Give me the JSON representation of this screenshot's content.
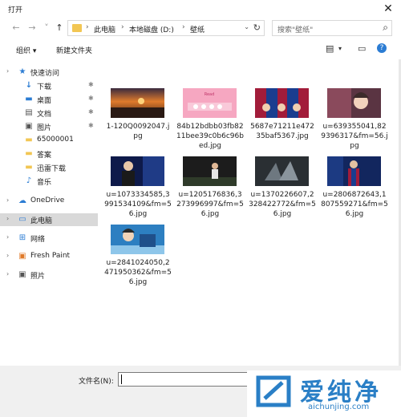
{
  "window": {
    "title": "打开",
    "close_glyph": "✕"
  },
  "nav": {
    "back": "←",
    "forward": "→",
    "recent": "˅",
    "up": "↑"
  },
  "breadcrumb": {
    "items": [
      "此电脑",
      "本地磁盘 (D:)",
      "壁纸"
    ],
    "separator": "›",
    "dropdown": "⌄",
    "refresh": "↻"
  },
  "search": {
    "placeholder": "搜索\"壁纸\"",
    "icon": "search-icon"
  },
  "toolbar": {
    "organize": "组织 ▾",
    "new_folder": "新建文件夹",
    "view_icon": "▤",
    "view_dd": "▾",
    "pane_icon": "▭",
    "help_icon": "?"
  },
  "sidebar": {
    "items": [
      {
        "label": "快速访问",
        "icon": "★",
        "color": "#2b7cd3"
      },
      {
        "label": "下载",
        "icon": "↓",
        "color": "#2b7cd3",
        "pinned": true
      },
      {
        "label": "桌面",
        "icon": "▬",
        "color": "#2b7cd3",
        "pinned": true
      },
      {
        "label": "文档",
        "icon": "▤",
        "color": "#555555",
        "pinned": true
      },
      {
        "label": "图片",
        "icon": "▣",
        "color": "#555555",
        "pinned": true
      },
      {
        "label": "65000001",
        "icon": "▬",
        "color": "#f2c653"
      },
      {
        "label": "答案",
        "icon": "▬",
        "color": "#f2c653"
      },
      {
        "label": "迅雷下载",
        "icon": "▬",
        "color": "#f2c653"
      },
      {
        "label": "音乐",
        "icon": "♪",
        "color": "#2b7cd3"
      },
      {
        "label": "OneDrive",
        "icon": "☁",
        "color": "#2b7cd3"
      },
      {
        "label": "此电脑",
        "icon": "▭",
        "color": "#2b7cd3"
      },
      {
        "label": "网络",
        "icon": "⊞",
        "color": "#2b7cd3"
      },
      {
        "label": "Fresh Paint",
        "icon": "▣",
        "color": "#e07a2a"
      },
      {
        "label": "照片",
        "icon": "▣",
        "color": "#555555"
      }
    ],
    "pin_glyph": "✱",
    "chevron": "›"
  },
  "files": [
    {
      "name": "1-120Q0092047.jpg"
    },
    {
      "name": "84b12bdbb03fb8211bee39c0b6c96bed.jpg",
      "thumb_text": "Read"
    },
    {
      "name": "5687e71211e47235baf5367.jpg"
    },
    {
      "name": "u=639355041,829396317&fm=56.jpg"
    },
    {
      "name": "u=1073334585,3991534109&fm=56.jpg"
    },
    {
      "name": "u=1205176836,3273996997&fm=56.jpg"
    },
    {
      "name": "u=1370226607,2328422772&fm=56.jpg"
    },
    {
      "name": "u=2806872643,1807559271&fm=56.jpg"
    },
    {
      "name": "u=2841024050,2471950362&fm=56.jpg"
    }
  ],
  "bottom": {
    "filename_label": "文件名(N):",
    "filename_value": ""
  },
  "watermark": {
    "brand": "爱纯净",
    "url": "aichunjing.com"
  },
  "colors": {
    "accent": "#2b7cd3",
    "folder": "#f2c653",
    "selected": "#d9d9d9",
    "watermark": "#2a7fc6"
  }
}
